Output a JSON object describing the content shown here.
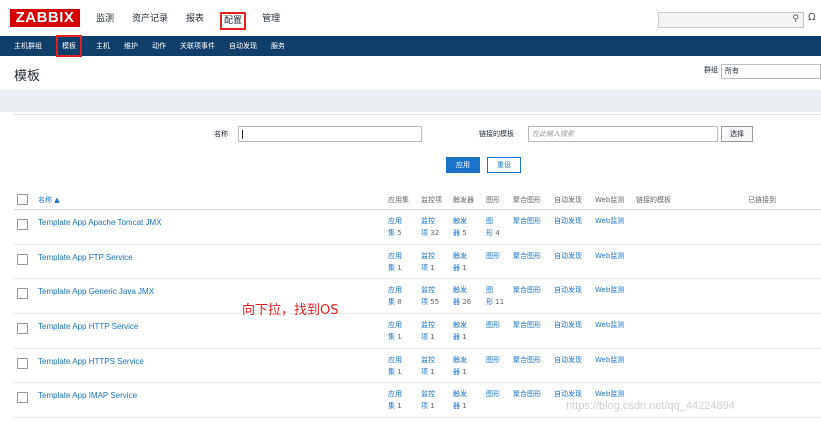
{
  "app": {
    "logo": "ZABBIX"
  },
  "topnav": [
    "监测",
    "资产记录",
    "报表",
    "配置",
    "管理"
  ],
  "search": {
    "icon": "search-icon",
    "support_icon": "support-icon",
    "search_glyph": "⚲",
    "support_glyph": "Ω"
  },
  "subnav": [
    "主机群组",
    "模板",
    "主机",
    "维护",
    "动作",
    "关联项事件",
    "自动发现",
    "服务"
  ],
  "page": {
    "title": "模板",
    "group_label": "群组",
    "group_value": "所有"
  },
  "filter": {
    "name_label": "名称",
    "name_value": "",
    "linked_label": "链接的模板",
    "linked_placeholder": "在此输入搜索",
    "select_label": "选择",
    "apply_label": "应用",
    "reset_label": "重设"
  },
  "table": {
    "headers": {
      "name": "名称 ▲",
      "applications": "应用集",
      "items": "监控项",
      "triggers": "触发器",
      "graphs": "图形",
      "screens": "聚合图形",
      "discovery": "自动发现",
      "web": "Web监测",
      "linked_templates": "链接的模板",
      "linked_to": "已链接到"
    },
    "rows": [
      {
        "name": "Template App Apache Tomcat JMX",
        "app_a": "应用",
        "app_b": "集",
        "app_n": "5",
        "item_a": "监控",
        "item_b": "项",
        "item_n": "32",
        "trig_a": "触发",
        "trig_b": "器",
        "trig_n": "5",
        "graph_a": "图",
        "graph_b": "形",
        "graph_n": "4",
        "screens": "聚合图形",
        "discovery": "自动发现",
        "web": "Web监测"
      },
      {
        "name": "Template App FTP Service",
        "app_a": "应用",
        "app_b": "集",
        "app_n": "1",
        "item_a": "监控",
        "item_b": "项",
        "item_n": "1",
        "trig_a": "触发",
        "trig_b": "器",
        "trig_n": "1",
        "graph_a": "图形",
        "graph_b": "",
        "graph_n": "",
        "screens": "聚合图形",
        "discovery": "自动发现",
        "web": "Web监测"
      },
      {
        "name": "Template App Generic Java JMX",
        "app_a": "应用",
        "app_b": "集",
        "app_n": "8",
        "item_a": "监控",
        "item_b": "项",
        "item_n": "55",
        "trig_a": "触发",
        "trig_b": "器",
        "trig_n": "26",
        "graph_a": "图",
        "graph_b": "形",
        "graph_n": "11",
        "screens": "聚合图形",
        "discovery": "自动发现",
        "web": "Web监测"
      },
      {
        "name": "Template App HTTP Service",
        "app_a": "应用",
        "app_b": "集",
        "app_n": "1",
        "item_a": "监控",
        "item_b": "项",
        "item_n": "1",
        "trig_a": "触发",
        "trig_b": "器",
        "trig_n": "1",
        "graph_a": "图形",
        "graph_b": "",
        "graph_n": "",
        "screens": "聚合图形",
        "discovery": "自动发现",
        "web": "Web监测"
      },
      {
        "name": "Template App HTTPS Service",
        "app_a": "应用",
        "app_b": "集",
        "app_n": "1",
        "item_a": "监控",
        "item_b": "项",
        "item_n": "1",
        "trig_a": "触发",
        "trig_b": "器",
        "trig_n": "1",
        "graph_a": "图形",
        "graph_b": "",
        "graph_n": "",
        "screens": "聚合图形",
        "discovery": "自动发现",
        "web": "Web监测"
      },
      {
        "name": "Template App IMAP Service",
        "app_a": "应用",
        "app_b": "集",
        "app_n": "1",
        "item_a": "监控",
        "item_b": "项",
        "item_n": "1",
        "trig_a": "触发",
        "trig_b": "器",
        "trig_n": "1",
        "graph_a": "图形",
        "graph_b": "",
        "graph_n": "",
        "screens": "聚合图形",
        "discovery": "自动发现",
        "web": "Web监测"
      }
    ]
  },
  "annotation": "向下拉，找到OS",
  "watermark": "https://blog.csdn.net/qq_44224894",
  "colors": {
    "brand": "#d40000",
    "nav": "#0e3f6b",
    "link": "#1a73c7",
    "highlight": "#e02020"
  }
}
